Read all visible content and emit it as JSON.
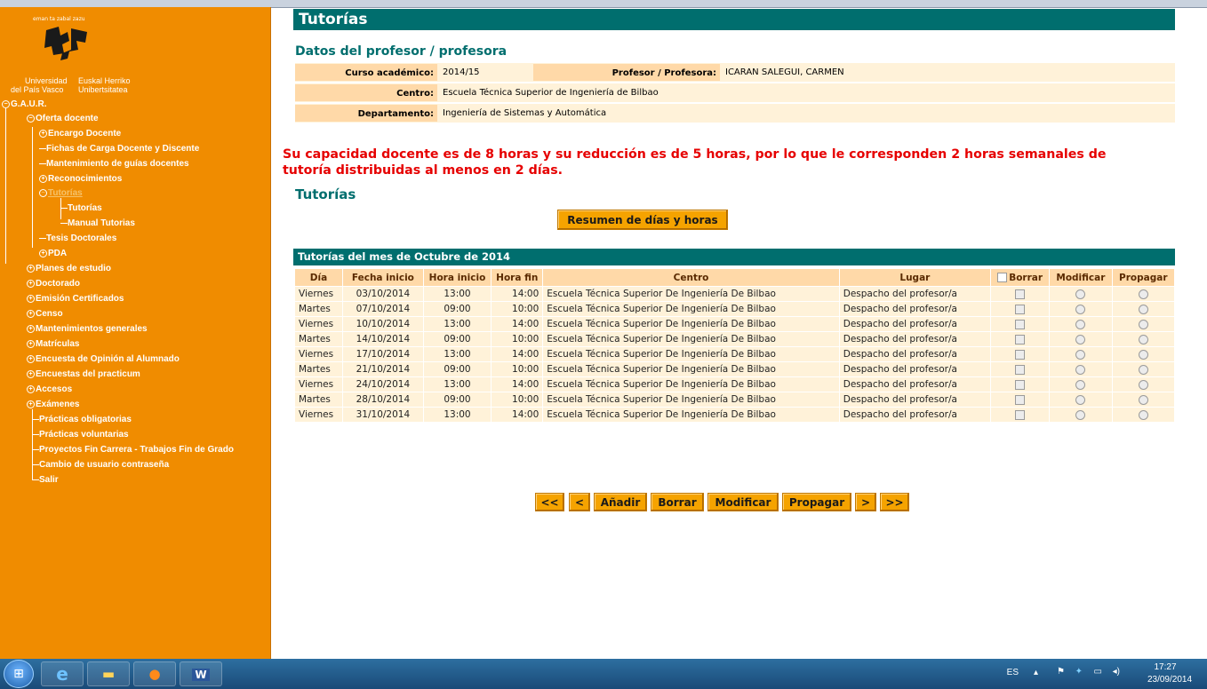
{
  "sidebar": {
    "motto": "eman ta zabal zazu",
    "uni_es_1": "Universidad",
    "uni_es_2": "del País Vasco",
    "uni_eu_1": "Euskal Herriko",
    "uni_eu_2": "Unibertsitatea",
    "root": "G.A.U.R.",
    "items": [
      "Oferta docente",
      "Encargo Docente",
      "Fichas de Carga Docente y Discente",
      "Mantenimiento de guías docentes",
      "Reconocimientos",
      "Tutorías",
      "Tutorías",
      "Manual Tutorias",
      "Tesis Doctorales",
      "PDA",
      "Planes de estudio",
      "Doctorado",
      "Emisión Certificados",
      "Censo",
      "Mantenimientos generales",
      "Matrículas",
      "Encuesta de Opinión al Alumnado",
      "Encuestas del practicum",
      "Accesos",
      "Exámenes",
      "Prácticas obligatorias",
      "Prácticas voluntarias",
      "Proyectos Fin Carrera - Trabajos Fin de Grado",
      "Cambio de usuario contraseña",
      "Salir"
    ]
  },
  "main": {
    "title": "Tutorías",
    "datos_heading": "Datos del profesor / profesora",
    "curso_label": "Curso académico:",
    "curso_value": "2014/15",
    "profesor_label": "Profesor / Profesora:",
    "profesor_value": "ICARAN SALEGUI, CARMEN",
    "centro_label": "Centro:",
    "centro_value": "Escuela Técnica Superior de Ingeniería de Bilbao",
    "depto_label": "Departamento:",
    "depto_value": "Ingeniería de Sistemas y Automática",
    "warning_line1": "Su capacidad docente es de 8 horas y su reducción es de 5 horas, por lo que le corresponden 2 horas semanales de",
    "warning_line2": "tutoría distribuidas al menos en 2 días.",
    "tutorias_heading": "Tutorías",
    "resumen_button": "Resumen de días y horas",
    "grid_title": "Tutorías del mes de Octubre de 2014",
    "columns": [
      "Día",
      "Fecha inicio",
      "Hora inicio",
      "Hora fin",
      "Centro",
      "Lugar",
      "Borrar",
      "Modificar",
      "Propagar"
    ],
    "rows": [
      {
        "dia": "Viernes",
        "fecha": "03/10/2014",
        "inicio": "13:00",
        "fin": "14:00",
        "centro": "Escuela Técnica Superior De Ingeniería De Bilbao",
        "lugar": "Despacho del profesor/a"
      },
      {
        "dia": "Martes",
        "fecha": "07/10/2014",
        "inicio": "09:00",
        "fin": "10:00",
        "centro": "Escuela Técnica Superior De Ingeniería De Bilbao",
        "lugar": "Despacho del profesor/a"
      },
      {
        "dia": "Viernes",
        "fecha": "10/10/2014",
        "inicio": "13:00",
        "fin": "14:00",
        "centro": "Escuela Técnica Superior De Ingeniería De Bilbao",
        "lugar": "Despacho del profesor/a"
      },
      {
        "dia": "Martes",
        "fecha": "14/10/2014",
        "inicio": "09:00",
        "fin": "10:00",
        "centro": "Escuela Técnica Superior De Ingeniería De Bilbao",
        "lugar": "Despacho del profesor/a"
      },
      {
        "dia": "Viernes",
        "fecha": "17/10/2014",
        "inicio": "13:00",
        "fin": "14:00",
        "centro": "Escuela Técnica Superior De Ingeniería De Bilbao",
        "lugar": "Despacho del profesor/a"
      },
      {
        "dia": "Martes",
        "fecha": "21/10/2014",
        "inicio": "09:00",
        "fin": "10:00",
        "centro": "Escuela Técnica Superior De Ingeniería De Bilbao",
        "lugar": "Despacho del profesor/a"
      },
      {
        "dia": "Viernes",
        "fecha": "24/10/2014",
        "inicio": "13:00",
        "fin": "14:00",
        "centro": "Escuela Técnica Superior De Ingeniería De Bilbao",
        "lugar": "Despacho del profesor/a"
      },
      {
        "dia": "Martes",
        "fecha": "28/10/2014",
        "inicio": "09:00",
        "fin": "10:00",
        "centro": "Escuela Técnica Superior De Ingeniería De Bilbao",
        "lugar": "Despacho del profesor/a"
      },
      {
        "dia": "Viernes",
        "fecha": "31/10/2014",
        "inicio": "13:00",
        "fin": "14:00",
        "centro": "Escuela Técnica Superior De Ingeniería De Bilbao",
        "lugar": "Despacho del profesor/a"
      }
    ],
    "nav_buttons": {
      "first": "<<",
      "prev": "<",
      "add": "Añadir",
      "delete": "Borrar",
      "modify": "Modificar",
      "propagate": "Propagar",
      "next": ">",
      "last": ">>"
    }
  },
  "taskbar": {
    "language": "ES",
    "time": "17:27",
    "date": "23/09/2014"
  },
  "colors": {
    "sidebar": "#f08c00",
    "title_bar": "#006e6e",
    "warning": "#e60000",
    "label_cell": "#ffd9a8",
    "value_cell": "#fff2d9",
    "button": "#f5a300"
  }
}
